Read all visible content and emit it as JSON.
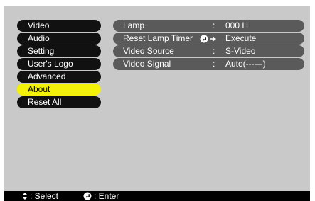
{
  "menu": {
    "items": [
      {
        "label": "Video"
      },
      {
        "label": "Audio"
      },
      {
        "label": "Setting"
      },
      {
        "label": "User's Logo"
      },
      {
        "label": "Advanced"
      },
      {
        "label": "About"
      },
      {
        "label": "Reset All"
      }
    ],
    "selected_index": 5
  },
  "details": {
    "lamp": {
      "label": "Lamp",
      "colon": ":",
      "value": "000 H"
    },
    "reset_lamp_timer": {
      "label": "Reset Lamp Timer",
      "action": "Execute"
    },
    "video_source": {
      "label": "Video Source",
      "colon": ":",
      "value": "S-Video"
    },
    "video_signal": {
      "label": "Video Signal",
      "colon": ":",
      "value": "Auto(------)"
    }
  },
  "footer": {
    "select_text": ": Select",
    "enter_text": ": Enter"
  },
  "colors": {
    "menu_bg": "#111111",
    "menu_selected": "#f3f10a",
    "detail_bg": "#5a5a5a",
    "screen_bg": "#c9c9c9",
    "footer_bg": "#000000"
  }
}
